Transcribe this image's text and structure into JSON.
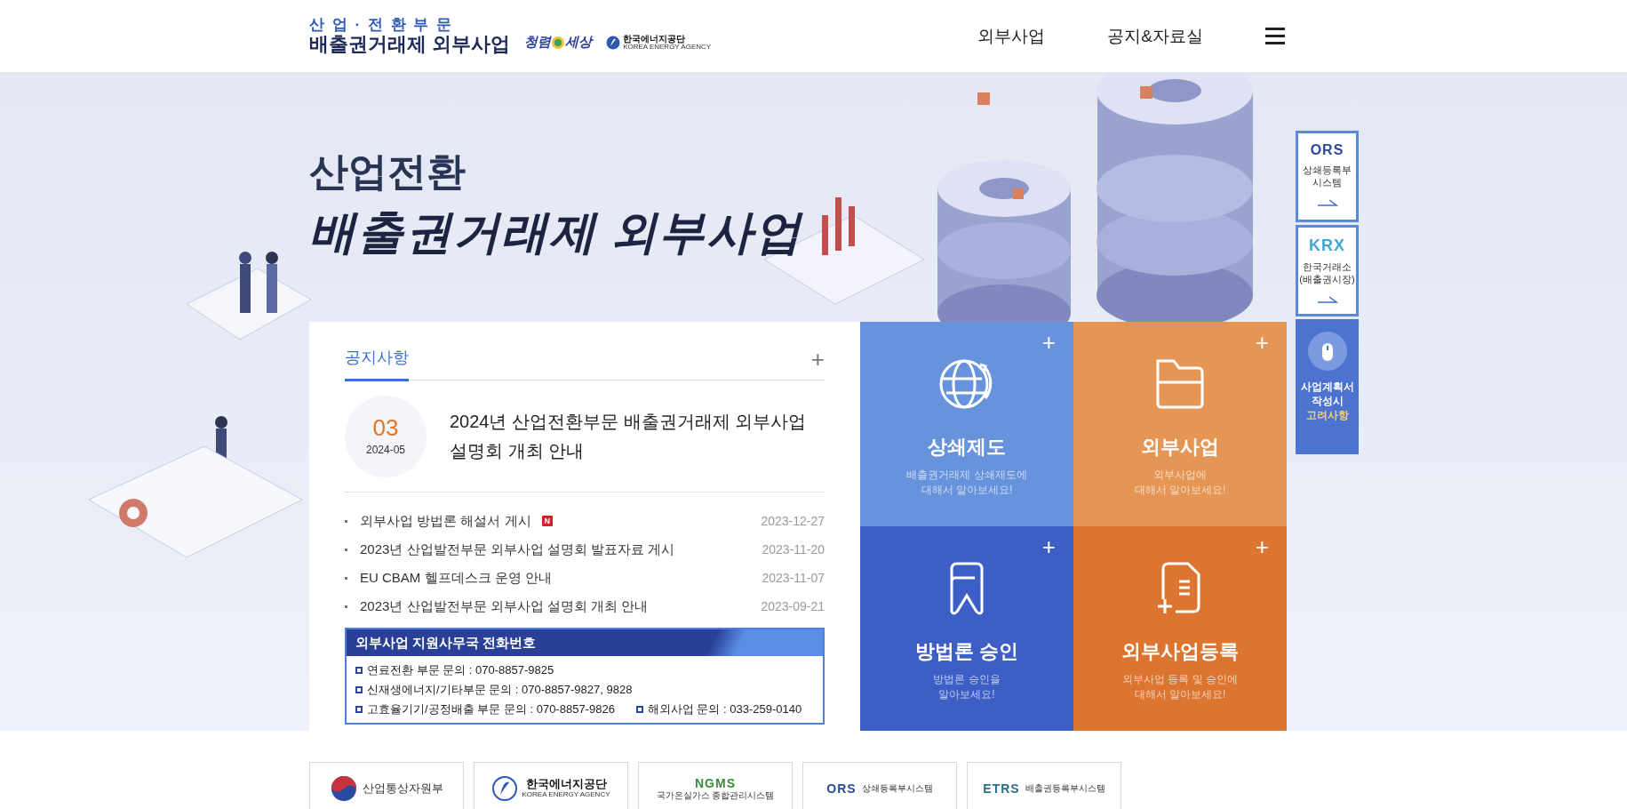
{
  "header": {
    "logo": {
      "subtitle": "산 업 · 전 환 부 문",
      "title": "배출권거래제 외부사업"
    },
    "partner_logos": [
      {
        "kind": "clean",
        "text_1": "청렴",
        "text_2": "세상"
      },
      {
        "kind": "agency",
        "name": "한국에너지공단",
        "english": "KOREA ENERGY AGENCY"
      }
    ],
    "nav": [
      {
        "label": "외부사업"
      },
      {
        "label": "공지&자료실"
      }
    ]
  },
  "hero": {
    "line_1": "산업전환",
    "line_2": "배출권거래제 외부사업"
  },
  "notice": {
    "tabs": [
      {
        "label": "공지사항",
        "selected": true
      }
    ],
    "more": "+",
    "featured": {
      "day": "03",
      "month": "2024-05",
      "title": "2024년 산업전환부문 배출권거래제 외부사업 설명회 개최 안내"
    },
    "items": [
      {
        "title": "외부사업 방법론 해설서 게시",
        "new": true,
        "badge": "N",
        "date": "2023-12-27"
      },
      {
        "title": "2023년 산업발전부문 외부사업 설명회 발표자료 게시",
        "new": false,
        "date": "2023-11-20"
      },
      {
        "title": "EU CBAM 헬프데스크 운영 안내",
        "new": false,
        "date": "2023-11-07"
      },
      {
        "title": "2023년 산업발전부문 외부사업 설명회 개최 안내",
        "new": false,
        "date": "2023-09-21"
      }
    ],
    "contact": {
      "title": "외부사업 지원사무국 전화번호",
      "lines": [
        [
          "연료전환 부문 문의 : 070-8857-9825"
        ],
        [
          "신재생에너지/기타부문 문의 : 070-8857-9827, 9828"
        ],
        [
          "고효율기기/공정배출 부문 문의 : 070-8857-9826",
          "해외사업 문의 : 033-259-0140"
        ]
      ]
    }
  },
  "tiles": [
    {
      "kind": "globe",
      "color": "#6793dd",
      "title": "상쇄제도",
      "description": [
        "배출권거래제 상쇄제도에",
        "대해서 알아보세요!"
      ],
      "more": "+"
    },
    {
      "kind": "folder",
      "color": "#e59655",
      "title": "외부사업",
      "description": [
        "외부사업에",
        "대해서 알아보세요!"
      ],
      "more": "+"
    },
    {
      "kind": "bookmark",
      "color": "#3d5fc5",
      "title": "방법론 승인",
      "description": [
        "방법론 승인을",
        "알아보세요!"
      ],
      "more": "+"
    },
    {
      "kind": "document",
      "color": "#dc7530",
      "title": "외부사업등록",
      "description": [
        "외부사업 등록 및 승인에",
        "대해서 알아보세요!"
      ],
      "more": "+"
    }
  ],
  "quick_links": [
    {
      "kind": "ors",
      "logo": "ORS",
      "label": [
        "상쇄등록부",
        "시스템"
      ]
    },
    {
      "kind": "krx",
      "logo": "KRX",
      "label": [
        "한국거래소",
        "(배출권시장)"
      ]
    },
    {
      "kind": "guide",
      "label": [
        "사업계획서",
        "작성시"
      ],
      "highlight": "고려사항"
    }
  ],
  "footer_links": [
    {
      "kind": "ministry",
      "name": "산업통상자원부"
    },
    {
      "kind": "agency",
      "name": "한국에너지공단",
      "english": "KOREA ENERGY AGENCY"
    },
    {
      "kind": "ngms",
      "logo": "NGMS",
      "name": "국가온실가스 종합관리시스템"
    },
    {
      "kind": "ors",
      "logo": "ORS",
      "name": "상쇄등록부시스템"
    },
    {
      "kind": "etrs",
      "logo": "ETRS",
      "name": "배출권등록부시스템"
    }
  ]
}
